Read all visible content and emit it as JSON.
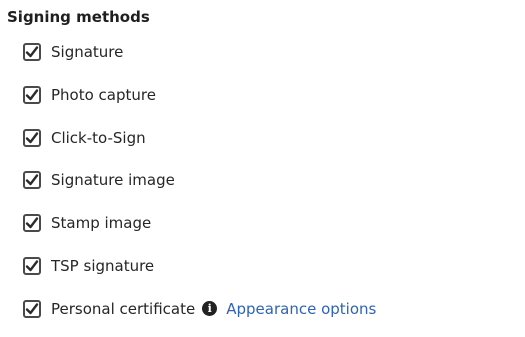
{
  "section": {
    "title": "Signing methods"
  },
  "options": [
    {
      "label": "Signature",
      "checked": true
    },
    {
      "label": "Photo capture",
      "checked": true
    },
    {
      "label": "Click-to-Sign",
      "checked": true
    },
    {
      "label": "Signature image",
      "checked": true
    },
    {
      "label": "Stamp image",
      "checked": true
    },
    {
      "label": "TSP signature",
      "checked": true
    },
    {
      "label": "Personal certificate",
      "checked": true
    }
  ],
  "personal_certificate": {
    "info_glyph": "i",
    "info_icon": "info-circle-icon",
    "link_text": "Appearance options"
  },
  "colors": {
    "link": "#2f63b4",
    "checkbox_border": "#4a4a4a",
    "checkmark": "#2b2b2b"
  }
}
